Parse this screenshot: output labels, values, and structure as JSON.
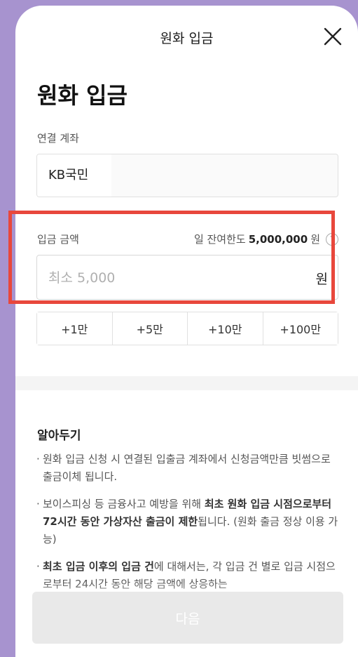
{
  "header": {
    "title": "원화 입금"
  },
  "page": {
    "title": "원화 입금"
  },
  "account": {
    "label": "연결 계좌",
    "value": "KB국민"
  },
  "amount": {
    "label": "입금 금액",
    "limit_prefix": "일 잔여한도",
    "limit_value": "5,000,000",
    "limit_unit": "원",
    "placeholder": "최소 5,000",
    "unit": "원"
  },
  "quick_buttons": [
    "+1만",
    "+5만",
    "+10만",
    "+100만"
  ],
  "notice": {
    "title": "알아두기",
    "item1": "원화 입금 신청 시 연결된 입출금 계좌에서 신청금액만큼 빗썸으로 출금이체 됩니다.",
    "item2_a": "보이스피싱 등 금융사고 예방을 위해 ",
    "item2_b": "최초 원화 입금 시점으로부터 72시간 동안 가상자산 출금이 제한",
    "item2_c": "됩니다. (원화 출금 정상 이용 가능)",
    "item3_a": "최초 입금 이후의 입금 건",
    "item3_b": "에 대해서는, 각 입금 건 별로 입금 시점으로부터 24시간 동안 해당 금액에 상응하는"
  },
  "footer": {
    "next_label": "다음"
  },
  "colors": {
    "highlight": "#e8473c",
    "background": "#a793cf"
  }
}
